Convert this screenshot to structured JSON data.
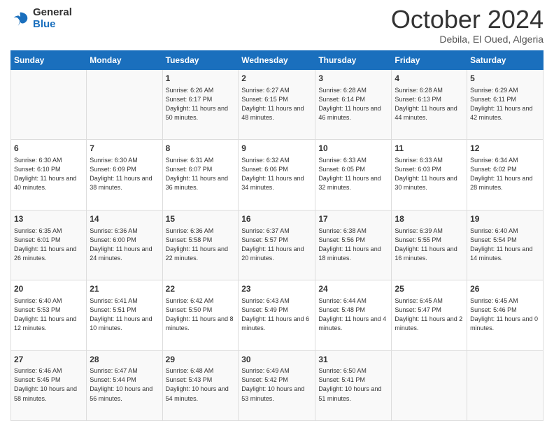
{
  "logo": {
    "line1": "General",
    "line2": "Blue"
  },
  "title": "October 2024",
  "location": "Debila, El Oued, Algeria",
  "days_header": [
    "Sunday",
    "Monday",
    "Tuesday",
    "Wednesday",
    "Thursday",
    "Friday",
    "Saturday"
  ],
  "weeks": [
    [
      {
        "day": "",
        "info": ""
      },
      {
        "day": "",
        "info": ""
      },
      {
        "day": "1",
        "info": "Sunrise: 6:26 AM\nSunset: 6:17 PM\nDaylight: 11 hours and 50 minutes."
      },
      {
        "day": "2",
        "info": "Sunrise: 6:27 AM\nSunset: 6:15 PM\nDaylight: 11 hours and 48 minutes."
      },
      {
        "day": "3",
        "info": "Sunrise: 6:28 AM\nSunset: 6:14 PM\nDaylight: 11 hours and 46 minutes."
      },
      {
        "day": "4",
        "info": "Sunrise: 6:28 AM\nSunset: 6:13 PM\nDaylight: 11 hours and 44 minutes."
      },
      {
        "day": "5",
        "info": "Sunrise: 6:29 AM\nSunset: 6:11 PM\nDaylight: 11 hours and 42 minutes."
      }
    ],
    [
      {
        "day": "6",
        "info": "Sunrise: 6:30 AM\nSunset: 6:10 PM\nDaylight: 11 hours and 40 minutes."
      },
      {
        "day": "7",
        "info": "Sunrise: 6:30 AM\nSunset: 6:09 PM\nDaylight: 11 hours and 38 minutes."
      },
      {
        "day": "8",
        "info": "Sunrise: 6:31 AM\nSunset: 6:07 PM\nDaylight: 11 hours and 36 minutes."
      },
      {
        "day": "9",
        "info": "Sunrise: 6:32 AM\nSunset: 6:06 PM\nDaylight: 11 hours and 34 minutes."
      },
      {
        "day": "10",
        "info": "Sunrise: 6:33 AM\nSunset: 6:05 PM\nDaylight: 11 hours and 32 minutes."
      },
      {
        "day": "11",
        "info": "Sunrise: 6:33 AM\nSunset: 6:03 PM\nDaylight: 11 hours and 30 minutes."
      },
      {
        "day": "12",
        "info": "Sunrise: 6:34 AM\nSunset: 6:02 PM\nDaylight: 11 hours and 28 minutes."
      }
    ],
    [
      {
        "day": "13",
        "info": "Sunrise: 6:35 AM\nSunset: 6:01 PM\nDaylight: 11 hours and 26 minutes."
      },
      {
        "day": "14",
        "info": "Sunrise: 6:36 AM\nSunset: 6:00 PM\nDaylight: 11 hours and 24 minutes."
      },
      {
        "day": "15",
        "info": "Sunrise: 6:36 AM\nSunset: 5:58 PM\nDaylight: 11 hours and 22 minutes."
      },
      {
        "day": "16",
        "info": "Sunrise: 6:37 AM\nSunset: 5:57 PM\nDaylight: 11 hours and 20 minutes."
      },
      {
        "day": "17",
        "info": "Sunrise: 6:38 AM\nSunset: 5:56 PM\nDaylight: 11 hours and 18 minutes."
      },
      {
        "day": "18",
        "info": "Sunrise: 6:39 AM\nSunset: 5:55 PM\nDaylight: 11 hours and 16 minutes."
      },
      {
        "day": "19",
        "info": "Sunrise: 6:40 AM\nSunset: 5:54 PM\nDaylight: 11 hours and 14 minutes."
      }
    ],
    [
      {
        "day": "20",
        "info": "Sunrise: 6:40 AM\nSunset: 5:53 PM\nDaylight: 11 hours and 12 minutes."
      },
      {
        "day": "21",
        "info": "Sunrise: 6:41 AM\nSunset: 5:51 PM\nDaylight: 11 hours and 10 minutes."
      },
      {
        "day": "22",
        "info": "Sunrise: 6:42 AM\nSunset: 5:50 PM\nDaylight: 11 hours and 8 minutes."
      },
      {
        "day": "23",
        "info": "Sunrise: 6:43 AM\nSunset: 5:49 PM\nDaylight: 11 hours and 6 minutes."
      },
      {
        "day": "24",
        "info": "Sunrise: 6:44 AM\nSunset: 5:48 PM\nDaylight: 11 hours and 4 minutes."
      },
      {
        "day": "25",
        "info": "Sunrise: 6:45 AM\nSunset: 5:47 PM\nDaylight: 11 hours and 2 minutes."
      },
      {
        "day": "26",
        "info": "Sunrise: 6:45 AM\nSunset: 5:46 PM\nDaylight: 11 hours and 0 minutes."
      }
    ],
    [
      {
        "day": "27",
        "info": "Sunrise: 6:46 AM\nSunset: 5:45 PM\nDaylight: 10 hours and 58 minutes."
      },
      {
        "day": "28",
        "info": "Sunrise: 6:47 AM\nSunset: 5:44 PM\nDaylight: 10 hours and 56 minutes."
      },
      {
        "day": "29",
        "info": "Sunrise: 6:48 AM\nSunset: 5:43 PM\nDaylight: 10 hours and 54 minutes."
      },
      {
        "day": "30",
        "info": "Sunrise: 6:49 AM\nSunset: 5:42 PM\nDaylight: 10 hours and 53 minutes."
      },
      {
        "day": "31",
        "info": "Sunrise: 6:50 AM\nSunset: 5:41 PM\nDaylight: 10 hours and 51 minutes."
      },
      {
        "day": "",
        "info": ""
      },
      {
        "day": "",
        "info": ""
      }
    ]
  ]
}
